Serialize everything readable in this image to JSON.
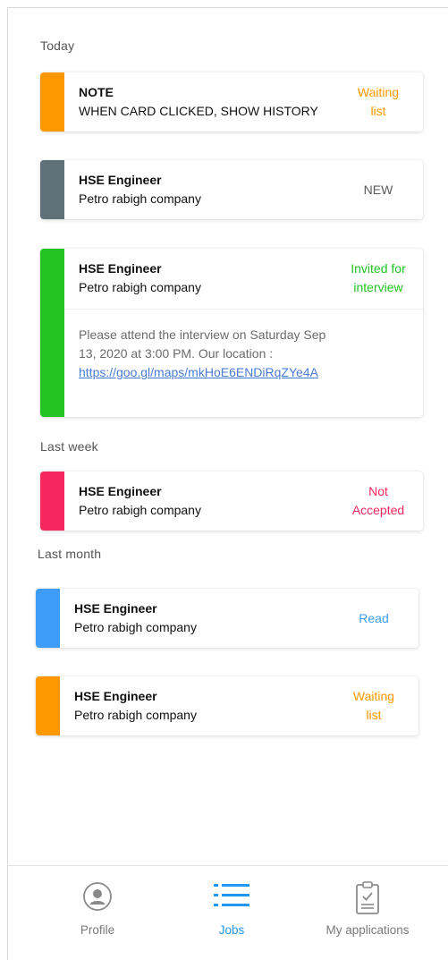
{
  "sections": {
    "today": "Today",
    "last_week": "Last week",
    "last_month": "Last month"
  },
  "cards": [
    {
      "title": "NOTE",
      "subtitle": "WHEN CARD CLICKED, SHOW HISTORY",
      "status_line1": "Waiting",
      "status_line2": "list",
      "color": "#ff9800"
    },
    {
      "title": "HSE Engineer",
      "subtitle": "Petro rabigh company",
      "status_line1": "NEW",
      "status_line2": "",
      "color": "#607078"
    },
    {
      "title": "HSE Engineer",
      "subtitle": "Petro rabigh company",
      "status_line1": "Invited for",
      "status_line2": "interview",
      "color": "#22c322",
      "message_line1": "Please attend the interview on Saturday Sep",
      "message_line2": "13, 2020 at 3:00 PM. Our location :",
      "link": "https://goo.gl/maps/mkHoE6ENDiRqZYe4A"
    },
    {
      "title": "HSE Engineer",
      "subtitle": "Petro rabigh company",
      "status_line1": "Not",
      "status_line2": "Accepted",
      "color": "#f5275e"
    },
    {
      "title": "HSE Engineer",
      "subtitle": "Petro rabigh company",
      "status_line1": "Read",
      "status_line2": "",
      "color": "#3d9cf5"
    },
    {
      "title": "HSE Engineer",
      "subtitle": "Petro rabigh company",
      "status_line1": "Waiting",
      "status_line2": "list",
      "color": "#ff9800"
    }
  ],
  "nav": {
    "profile": {
      "label": "Profile",
      "icon": "profile-icon"
    },
    "jobs": {
      "label": "Jobs",
      "icon": "list-icon"
    },
    "applications": {
      "label": "My applications",
      "icon": "clipboard-icon"
    }
  },
  "colors": {
    "active_tab": "#2196f3",
    "inactive_tab": "#8a8a8a"
  }
}
